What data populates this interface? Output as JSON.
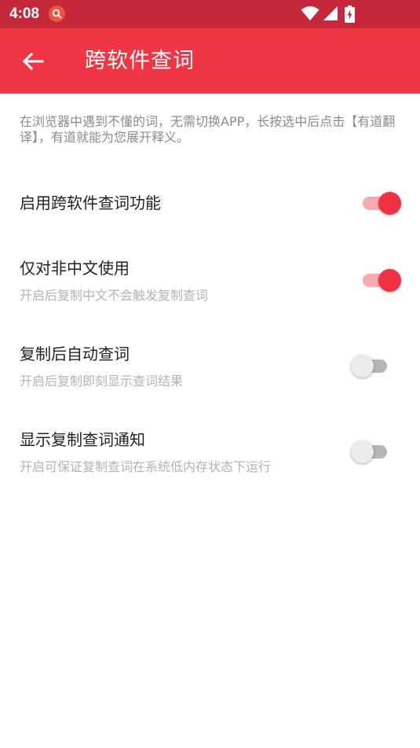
{
  "status_bar": {
    "time": "4:08"
  },
  "app_bar": {
    "title": "跨软件查词"
  },
  "description": "在浏览器中遇到不懂的词，无需切换APP，长按选中后点击【有道翻译】，有道就能为您展开释义。",
  "settings": [
    {
      "title": "启用跨软件查词功能",
      "subtitle": "",
      "enabled": true
    },
    {
      "title": "仅对非中文使用",
      "subtitle": "开启后复制中文不会触发复制查词",
      "enabled": true
    },
    {
      "title": "复制后自动查词",
      "subtitle": "开启后复制即刻显示查词结果",
      "enabled": false
    },
    {
      "title": "显示复制查词通知",
      "subtitle": "开启可保证复制查词在系统低内存状态下运行",
      "enabled": false
    }
  ],
  "colors": {
    "status_bar": "#c4283a",
    "app_bar": "#f03545",
    "toggle_on_thumb": "#ee3242",
    "toggle_on_track": "#f7aab2",
    "toggle_off_thumb": "#ececec",
    "toggle_off_track": "#b6b6b6"
  },
  "icons": {
    "status_notification": "search-notification-icon",
    "status_wifi": "wifi-icon",
    "status_signal": "cell-signal-icon",
    "status_battery": "battery-charging-icon",
    "back": "arrow-back-icon"
  }
}
